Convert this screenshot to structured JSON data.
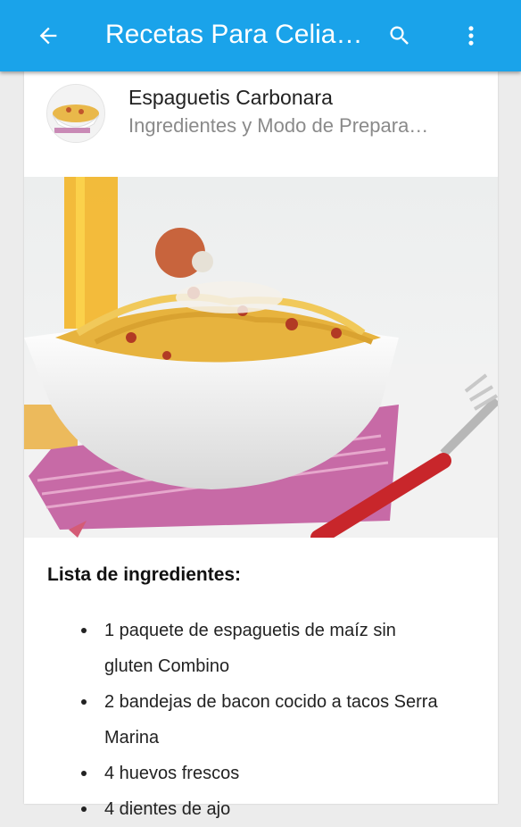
{
  "appbar": {
    "title": "Recetas Para Celia…",
    "icons": [
      "back-arrow-icon",
      "search-icon",
      "more-vert-icon"
    ],
    "color": "#1aa3ea"
  },
  "recipe": {
    "title": "Espaguetis Carbonara",
    "subtitle": "Ingredientes y Modo de Prepara…"
  },
  "ingredients": {
    "heading": "Lista de ingredientes:",
    "items": [
      "1 paquete de espaguetis de maíz sin gluten Combino",
      "2 bandejas de bacon cocido a tacos Serra Marina",
      "4 huevos frescos",
      "4 dientes de ajo"
    ]
  }
}
